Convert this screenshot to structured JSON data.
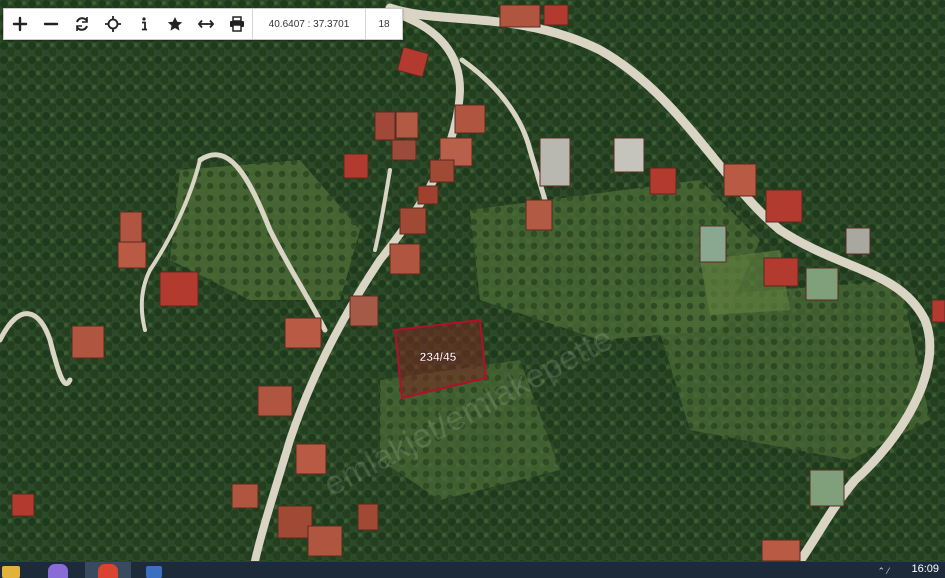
{
  "toolbar": {
    "buttons": [
      {
        "icon": "plus-icon",
        "name": "zoom-in-button"
      },
      {
        "icon": "minus-icon",
        "name": "zoom-out-button"
      },
      {
        "icon": "refresh-icon",
        "name": "refresh-button"
      },
      {
        "icon": "locate-icon",
        "name": "locate-button"
      },
      {
        "icon": "info-icon",
        "name": "info-button"
      },
      {
        "icon": "star-icon",
        "name": "favorite-button"
      },
      {
        "icon": "measure-icon",
        "name": "measure-button"
      },
      {
        "icon": "print-icon",
        "name": "print-button"
      }
    ],
    "coordinates": "40.6407 : 37.3701",
    "zoom_level": "18"
  },
  "map": {
    "parcel_label": "234/45",
    "watermark": "emlakjet/emlakepette",
    "colors": {
      "parcel_border": "#b0102a",
      "parcel_fill": "#7a2a22",
      "road": "#d9d4c4"
    }
  },
  "taskbar": {
    "time": "16:09"
  }
}
